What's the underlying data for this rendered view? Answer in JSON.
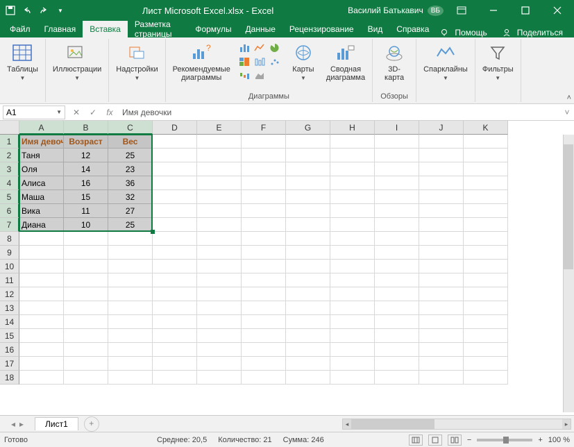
{
  "title": {
    "doc": "Лист Microsoft Excel.xlsx",
    "app": "Excel"
  },
  "user": {
    "name": "Василий Батькавич",
    "initials": "ВБ"
  },
  "menu": {
    "file": "Файл",
    "home": "Главная",
    "insert": "Вставка",
    "layout": "Разметка страницы",
    "formulas": "Формулы",
    "data": "Данные",
    "review": "Рецензирование",
    "view": "Вид",
    "help": "Справка",
    "tellme": "Помощь",
    "share": "Поделиться"
  },
  "ribbon": {
    "tables": "Таблицы",
    "illustrations": "Иллюстрации",
    "addins": "Надстройки",
    "rec_charts": "Рекомендуемые\nдиаграммы",
    "maps": "Карты",
    "pivot_chart": "Сводная\nдиаграмма",
    "map3d": "3D-\nкарта",
    "sparklines": "Спарклайны",
    "filters": "Фильтры",
    "group_charts": "Диаграммы",
    "group_tours": "Обзоры"
  },
  "namebox": "A1",
  "formula": "Имя девочки",
  "columns": [
    "A",
    "B",
    "C",
    "D",
    "E",
    "F",
    "G",
    "H",
    "I",
    "J",
    "K"
  ],
  "rows": [
    1,
    2,
    3,
    4,
    5,
    6,
    7,
    8,
    9,
    10,
    11,
    12,
    13,
    14,
    15,
    16,
    17,
    18
  ],
  "table": {
    "headers": [
      "Имя девочки",
      "Возраст",
      "Вес"
    ],
    "rows": [
      [
        "Таня",
        12,
        25
      ],
      [
        "Оля",
        14,
        23
      ],
      [
        "Алиса",
        16,
        36
      ],
      [
        "Маша",
        15,
        32
      ],
      [
        "Вика",
        11,
        27
      ],
      [
        "Диана",
        10,
        25
      ]
    ]
  },
  "sheet_tab": "Лист1",
  "status": {
    "ready": "Готово",
    "avg_label": "Среднее:",
    "avg_val": "20,5",
    "count_label": "Количество:",
    "count_val": "21",
    "sum_label": "Сумма:",
    "sum_val": "246",
    "zoom": "100 %"
  }
}
